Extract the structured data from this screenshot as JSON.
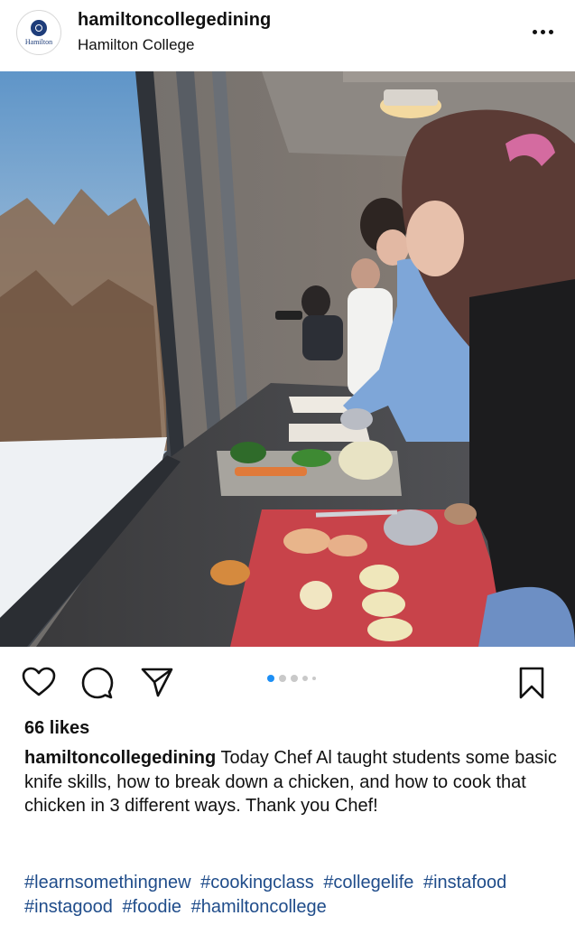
{
  "account": {
    "username": "hamiltoncollegedining",
    "location": "Hamilton College",
    "avatar_text": "Hamilton"
  },
  "post": {
    "likes": "66 likes",
    "caption_user": "hamiltoncollegedining",
    "caption_text": "Today Chef Al taught students some basic knife skills, how to break down a chicken, and how to cook that chicken in 3 different ways. Thank you Chef!",
    "hashtags": [
      "#learnsomethingnew",
      "#cookingclass",
      "#collegelife",
      "#instafood",
      "#instagood",
      "#foodie",
      "#hamiltoncollege"
    ],
    "carousel": {
      "total": 5,
      "active": 1
    }
  },
  "icons": {
    "like": "heart-icon",
    "comment": "comment-icon",
    "share": "send-icon",
    "save": "bookmark-icon",
    "more": "more-options-icon"
  },
  "colors": {
    "link": "#1f4c8a",
    "active_dot": "#1d8ff5"
  }
}
